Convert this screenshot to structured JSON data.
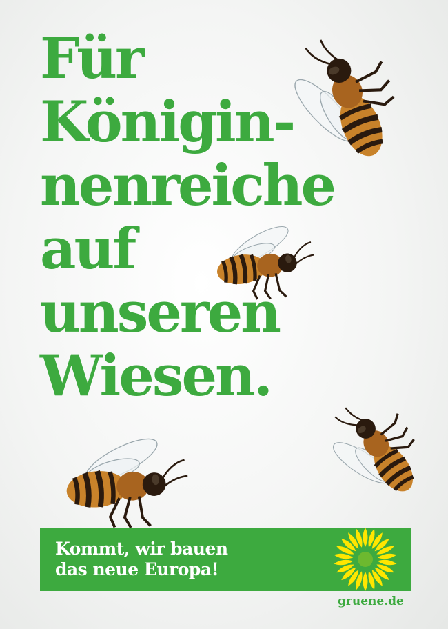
{
  "headline": {
    "lines": [
      "Für",
      "Königin-",
      "nenreiche",
      "auf",
      "unseren",
      "Wiesen."
    ]
  },
  "banner": {
    "line1": "Kommt, wir bauen",
    "line2": "das neue Europa!"
  },
  "footer": {
    "url": "gruene.de"
  },
  "colors": {
    "brand_green": "#3daa3f",
    "sunflower_yellow": "#ffe600",
    "bee_amber": "#c8822a",
    "bee_dark": "#2a1a0e"
  },
  "icons": {
    "logo": "sunflower-icon",
    "decor": "bee-icon"
  }
}
